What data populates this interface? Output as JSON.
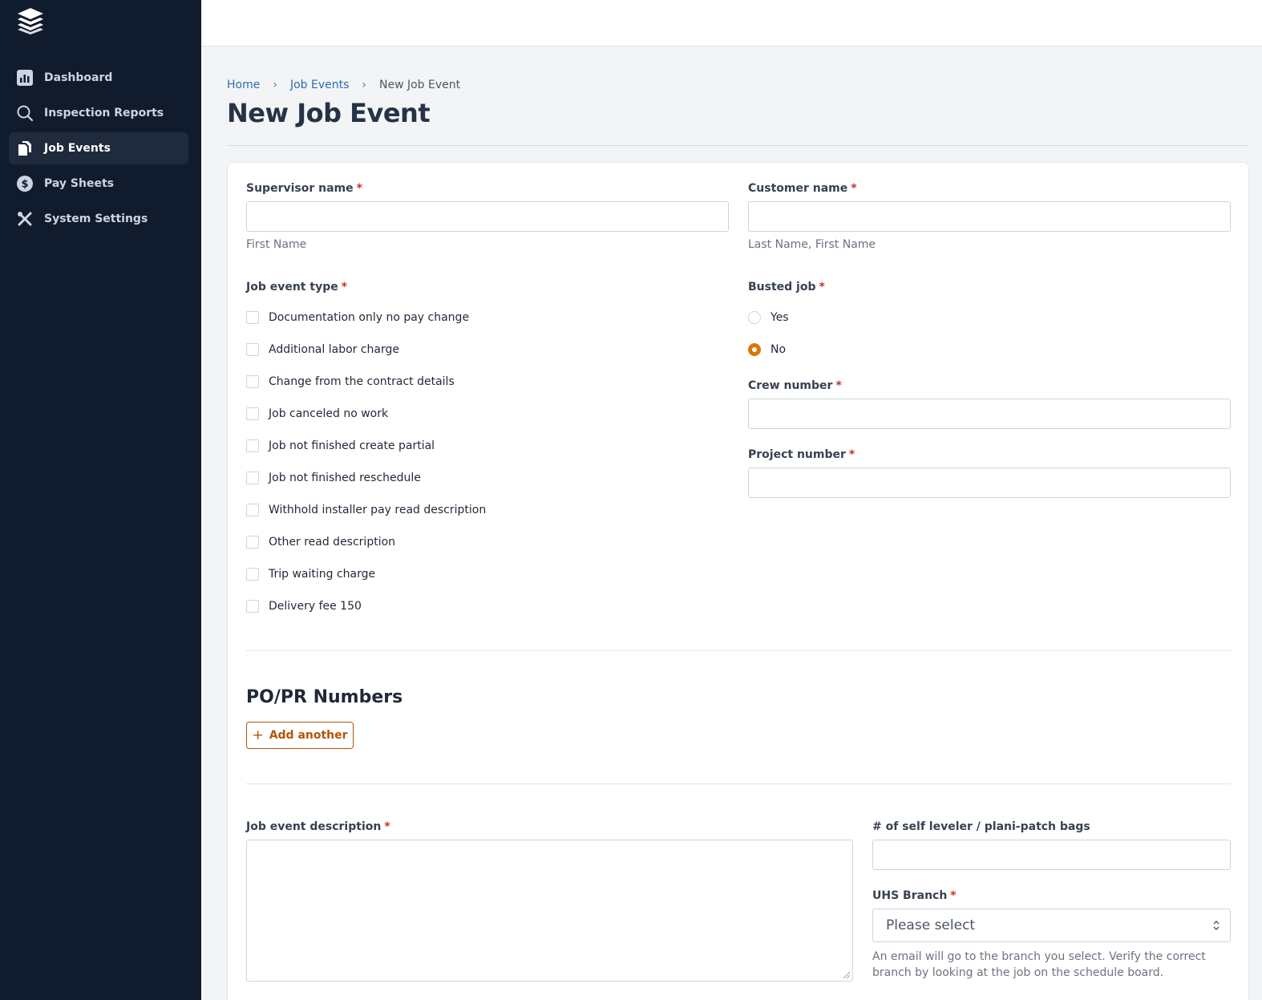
{
  "sidebar": {
    "items": [
      {
        "label": "Dashboard",
        "icon": "chart-icon"
      },
      {
        "label": "Inspection Reports",
        "icon": "search-icon"
      },
      {
        "label": "Job Events",
        "icon": "documents-icon",
        "active": true
      },
      {
        "label": "Pay Sheets",
        "icon": "dollar-icon"
      },
      {
        "label": "System Settings",
        "icon": "tools-icon"
      }
    ]
  },
  "breadcrumb": {
    "home": "Home",
    "sep": "›",
    "job_events": "Job Events",
    "current": "New Job Event"
  },
  "page": {
    "title": "New Job Event"
  },
  "form": {
    "required_mark": "*",
    "supervisor": {
      "label": "Supervisor name",
      "value": "",
      "help": "First Name"
    },
    "customer": {
      "label": "Customer name",
      "value": "",
      "help": "Last Name, First Name"
    },
    "job_event_type": {
      "label": "Job event type",
      "options": [
        "Documentation only no pay change",
        "Additional labor charge",
        "Change from the contract details",
        "Job canceled no work",
        "Job not finished create partial",
        "Job not finished reschedule",
        "Withhold installer pay read description",
        "Other read description",
        "Trip waiting charge",
        "Delivery fee 150"
      ]
    },
    "busted_job": {
      "label": "Busted job",
      "yes": "Yes",
      "no": "No",
      "selected": "No"
    },
    "crew_number": {
      "label": "Crew number",
      "value": ""
    },
    "project_number": {
      "label": "Project number",
      "value": ""
    },
    "po_pr": {
      "title": "PO/PR Numbers",
      "add_label": "Add another",
      "add_icon": "+"
    },
    "description": {
      "label": "Job event description",
      "value": ""
    },
    "bags": {
      "label": "# of self leveler / plani-patch bags",
      "value": ""
    },
    "branch": {
      "label": "UHS Branch",
      "placeholder": "Please select",
      "help": "An email will go to the branch you select. Verify the correct branch by looking at the job on the schedule board."
    }
  },
  "colors": {
    "sidebar_bg": "#111b2e",
    "link": "#2b6cb0",
    "accent": "#d97706",
    "required": "#c53030"
  }
}
